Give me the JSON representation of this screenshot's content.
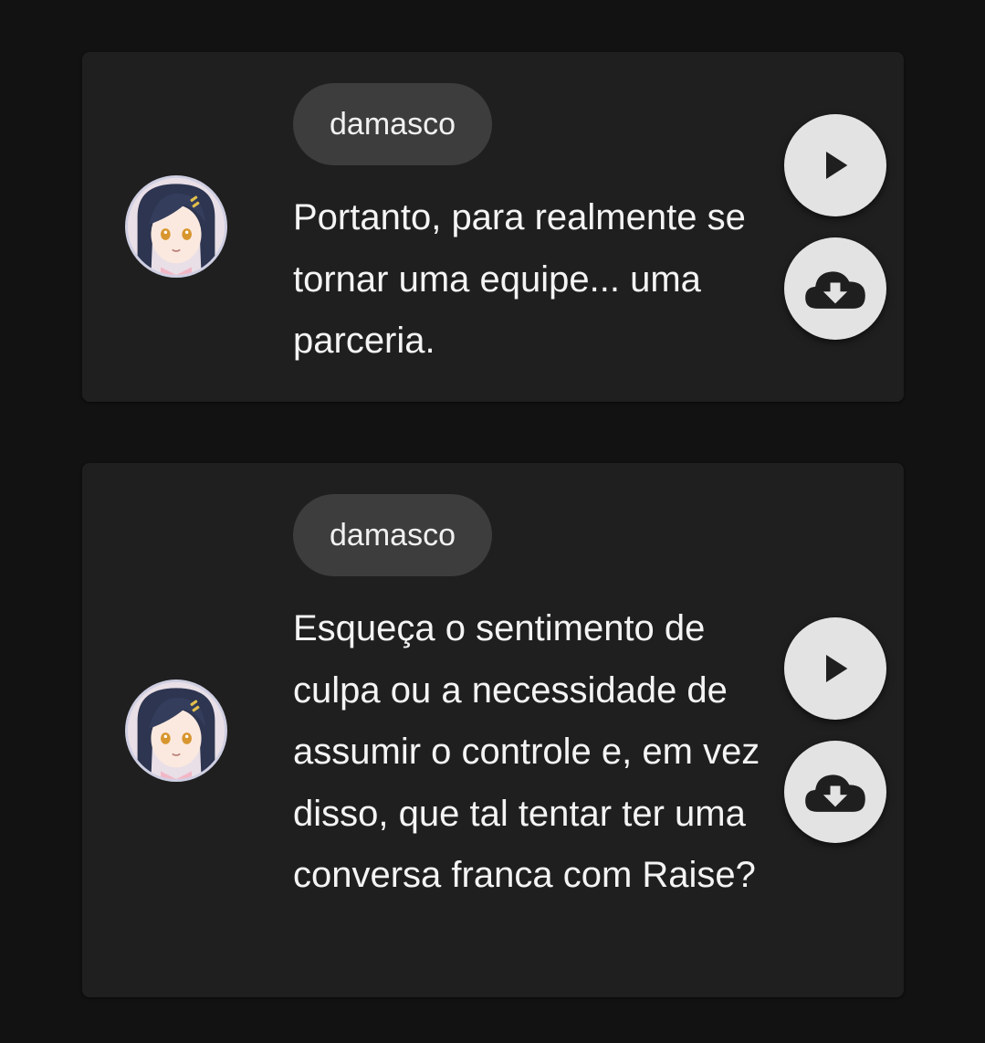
{
  "colors": {
    "background": "#121212",
    "card": "#1f1f1f",
    "chip": "#3d3d3d",
    "button": "#e3e3e3",
    "icon": "#1f1f1f"
  },
  "messages": [
    {
      "speaker": "damasco",
      "text": "Portanto, para realmente se tornar uma equipe... uma parceria.",
      "avatar_icon": "anime-girl-avatar-icon",
      "actions": [
        "play-icon",
        "cloud-download-icon"
      ]
    },
    {
      "speaker": "damasco",
      "text": "Esqueça o sentimento de culpa ou a necessidade de assumir o controle e, em vez disso, que tal tentar ter uma conversa franca com Raise?",
      "avatar_icon": "anime-girl-avatar-icon",
      "actions": [
        "play-icon",
        "cloud-download-icon"
      ]
    }
  ]
}
